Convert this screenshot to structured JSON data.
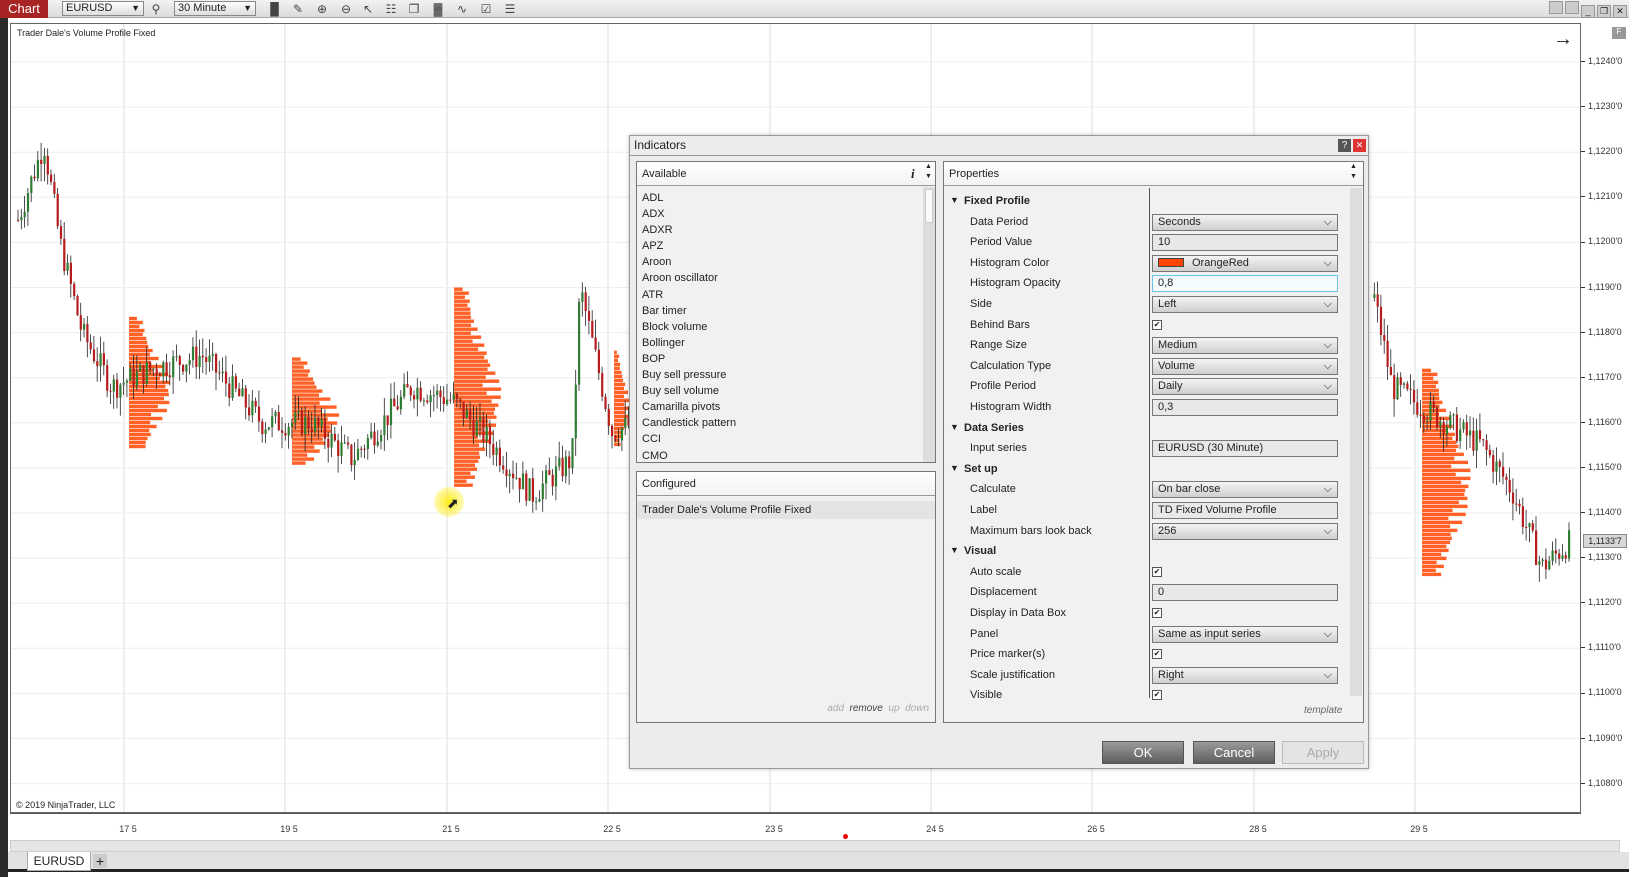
{
  "toolbar": {
    "chart_label": "Chart",
    "instrument": "EURUSD",
    "interval": "30 Minute",
    "icons": [
      "bar-type-icon",
      "pencil-icon",
      "zoom-in-icon",
      "zoom-out-icon",
      "pointer-icon",
      "data-box-icon",
      "properties-icon",
      "indicators-icon",
      "strategies-icon",
      "templates-icon",
      "list-icon"
    ]
  },
  "chart": {
    "indicator_label": "Trader Dale's Volume Profile Fixed",
    "copyright": "© 2019 NinjaTrader, LLC",
    "price_ticks": [
      "1,1240'0",
      "1,1230'0",
      "1,1220'0",
      "1,1210'0",
      "1,1200'0",
      "1,1190'0",
      "1,1180'0",
      "1,1170'0",
      "1,1160'0",
      "1,1150'0",
      "1,1140'0",
      "1,1130'0",
      "1,1120'0",
      "1,1110'0",
      "1,1100'0",
      "1,1090'0",
      "1,1080'0"
    ],
    "last_price": "1,1133'7",
    "time_ticks": [
      "17 5",
      "19 5",
      "21 5",
      "22 5",
      "23 5",
      "24 5",
      "26 5",
      "28 5",
      "29 5"
    ],
    "colors": {
      "histogram": "#ff4500",
      "up": "#2e7d32",
      "down": "#b71c1c"
    }
  },
  "tabs": {
    "active": "EURUSD",
    "add": "+"
  },
  "dialog": {
    "title": "Indicators",
    "help": "?",
    "close": "✕",
    "available": {
      "header": "Available",
      "info": "i",
      "items": [
        "ADL",
        "ADX",
        "ADXR",
        "APZ",
        "Aroon",
        "Aroon oscillator",
        "ATR",
        "Bar timer",
        "Block volume",
        "Bollinger",
        "BOP",
        "Buy sell pressure",
        "Buy sell volume",
        "Camarilla pivots",
        "Candlestick pattern",
        "CCI",
        "CMO"
      ]
    },
    "configured": {
      "header": "Configured",
      "items": [
        "Trader Dale's Volume Profile Fixed"
      ],
      "actions": [
        "add",
        "remove",
        "up",
        "down"
      ]
    },
    "properties": {
      "header": "Properties",
      "template": "template",
      "rows": [
        {
          "cat": "Fixed Profile"
        },
        {
          "label": "Data Period",
          "type": "dd",
          "value": "Seconds"
        },
        {
          "label": "Period Value",
          "type": "text",
          "value": "10"
        },
        {
          "label": "Histogram Color",
          "type": "color",
          "value": "OrangeRed",
          "swatch": "#ff4500"
        },
        {
          "label": "Histogram Opacity",
          "type": "focus",
          "value": "0,8"
        },
        {
          "label": "Side",
          "type": "dd",
          "value": "Left"
        },
        {
          "label": "Behind Bars",
          "type": "chk",
          "value": "✔"
        },
        {
          "label": "Range Size",
          "type": "dd",
          "value": "Medium"
        },
        {
          "label": "Calculation Type",
          "type": "dd",
          "value": "Volume"
        },
        {
          "label": "Profile Period",
          "type": "dd",
          "value": "Daily"
        },
        {
          "label": "Histogram Width",
          "type": "text",
          "value": "0,3"
        },
        {
          "cat": "Data Series"
        },
        {
          "label": "Input series",
          "type": "text",
          "value": "EURUSD (30 Minute)"
        },
        {
          "cat": "Set up"
        },
        {
          "label": "Calculate",
          "type": "dd",
          "value": "On bar close"
        },
        {
          "label": "Label",
          "type": "text",
          "value": "TD Fixed Volume Profile"
        },
        {
          "label": "Maximum bars look back",
          "type": "dd",
          "value": "256"
        },
        {
          "cat": "Visual"
        },
        {
          "label": "Auto scale",
          "type": "chk",
          "value": "✔"
        },
        {
          "label": "Displacement",
          "type": "text",
          "value": "0"
        },
        {
          "label": "Display in Data Box",
          "type": "chk",
          "value": "✔"
        },
        {
          "label": "Panel",
          "type": "dd",
          "value": "Same as input series"
        },
        {
          "label": "Price marker(s)",
          "type": "chk",
          "value": "✔"
        },
        {
          "label": "Scale justification",
          "type": "dd",
          "value": "Right"
        },
        {
          "label": "Visible",
          "type": "chk",
          "value": "✔"
        }
      ]
    }
  },
  "buttons": {
    "ok": "OK",
    "cancel": "Cancel",
    "apply": "Apply"
  }
}
